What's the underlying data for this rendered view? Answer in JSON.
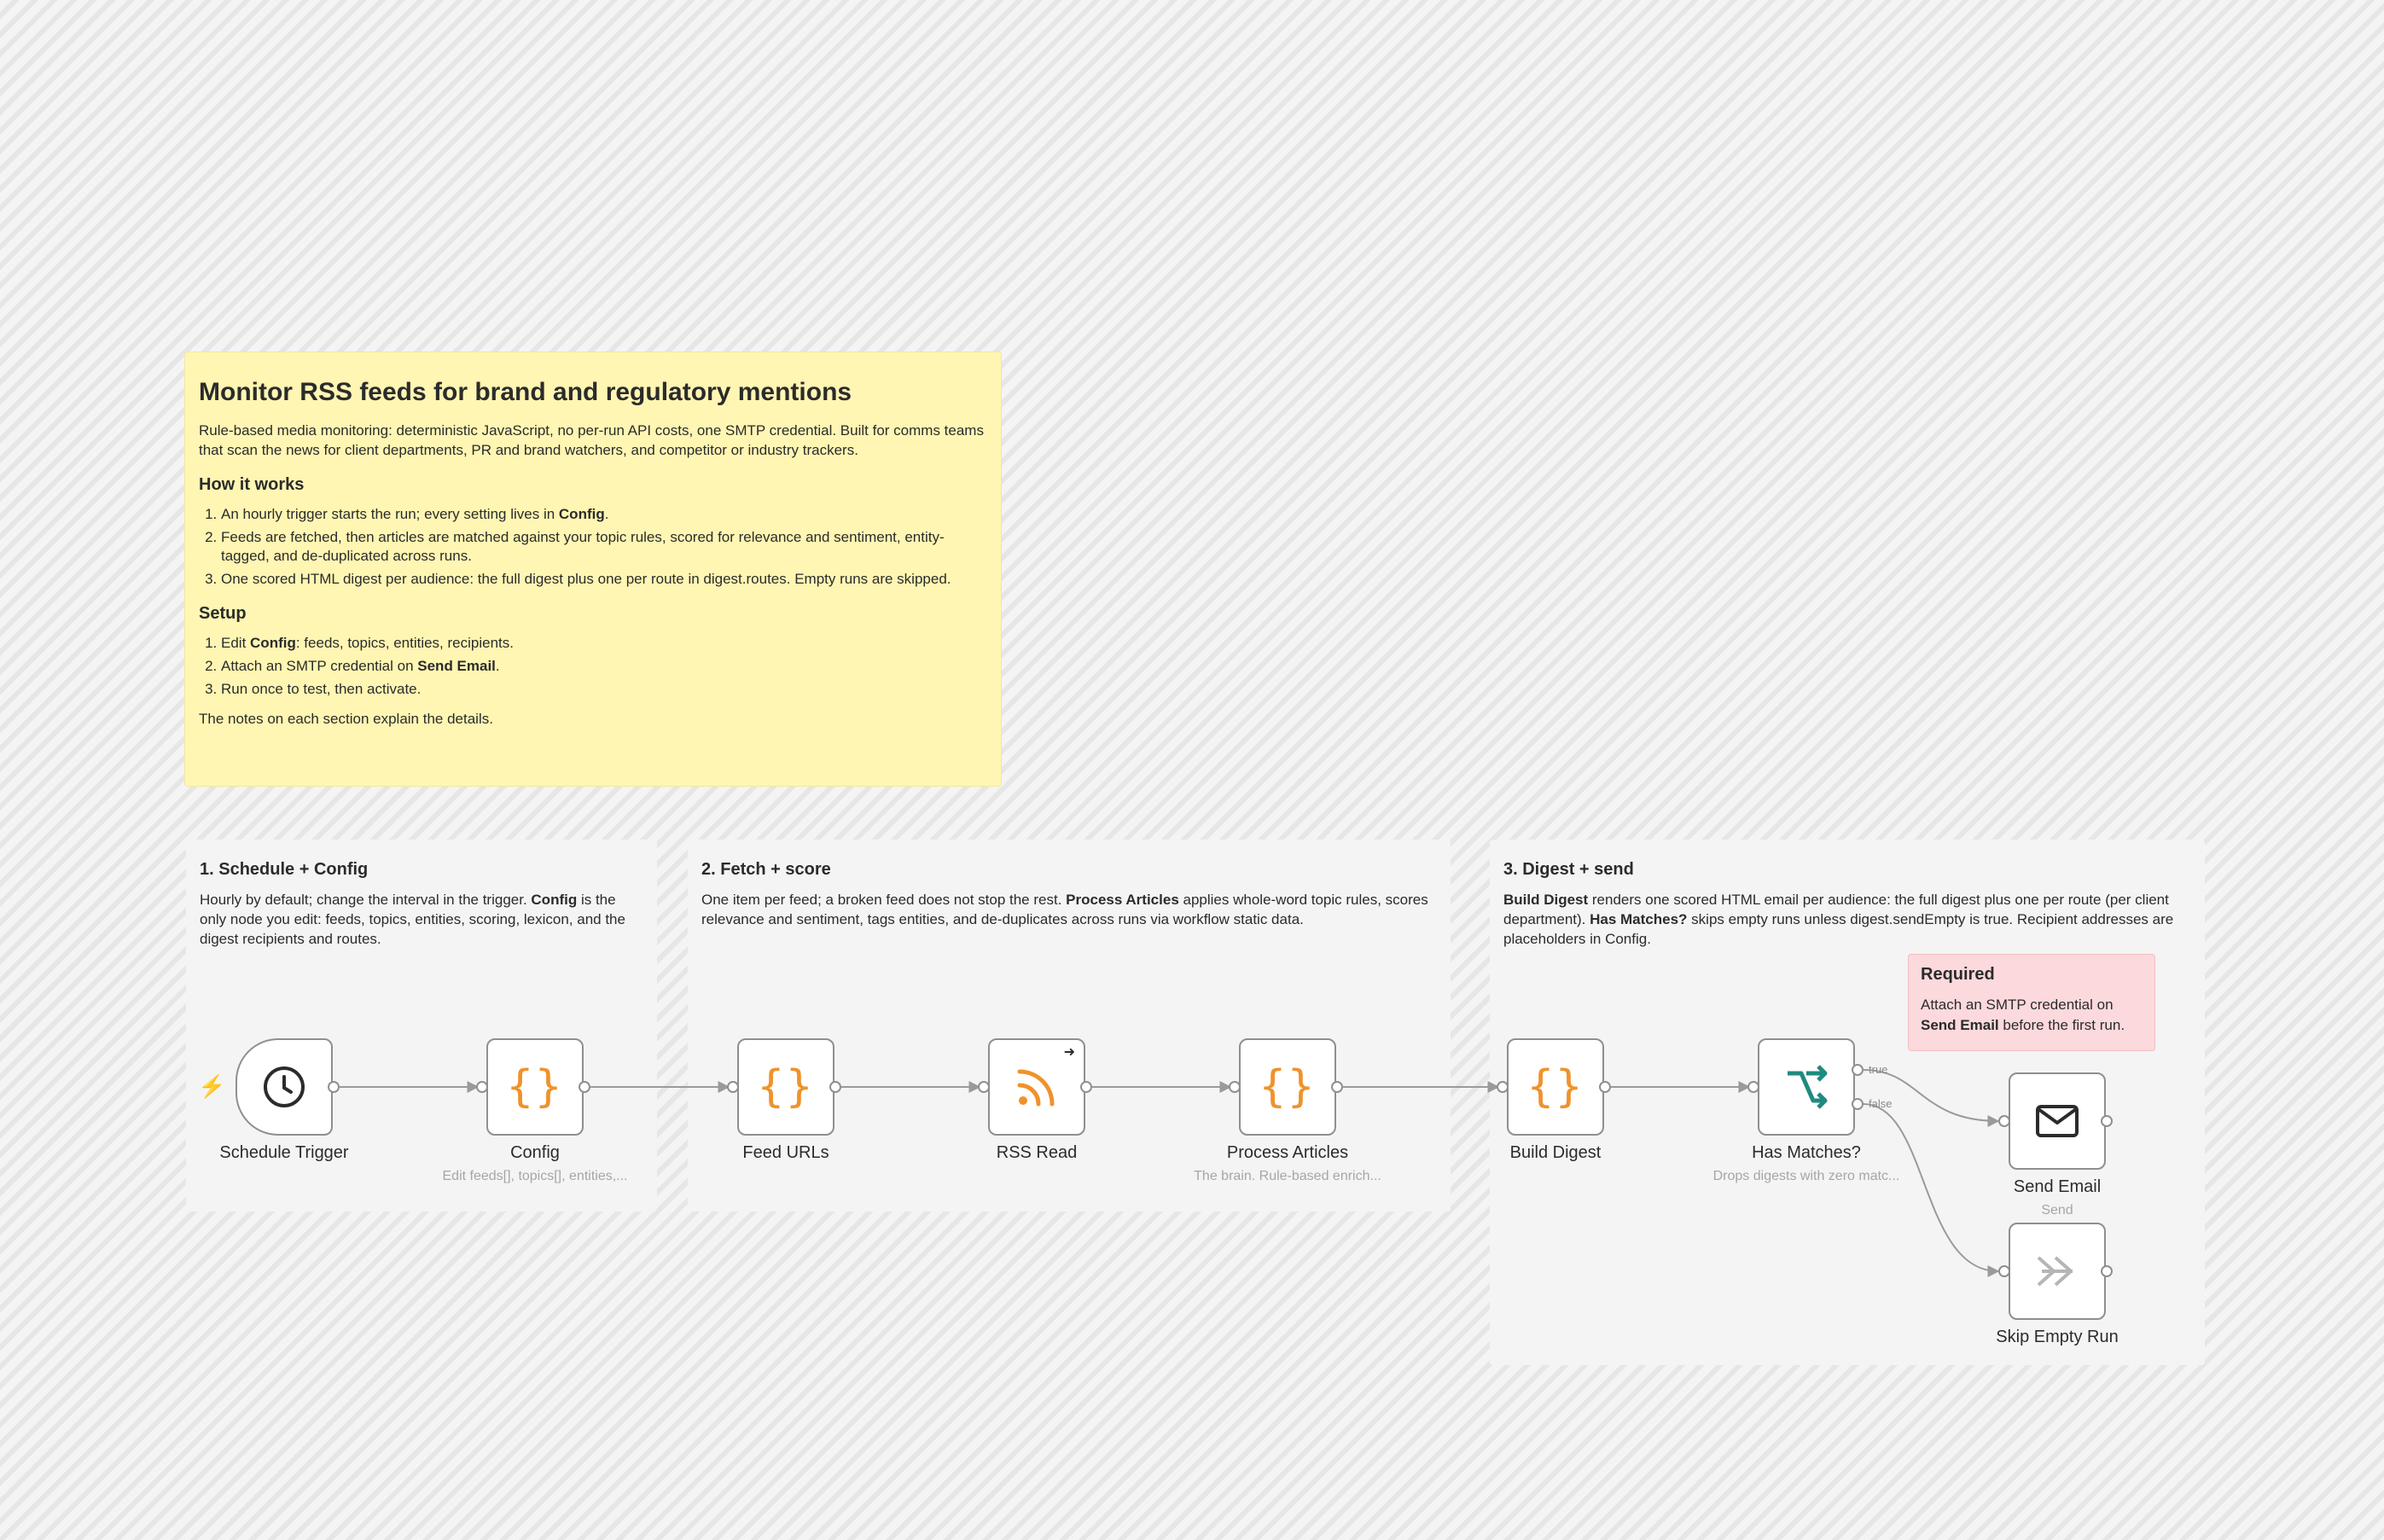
{
  "main_note": {
    "title": "Monitor RSS feeds for brand and regulatory mentions",
    "intro": "Rule-based media monitoring: deterministic JavaScript, no per-run API costs, one SMTP credential. Built for comms teams that scan the news for client departments, PR and brand watchers, and competitor or industry trackers.",
    "how_heading": "How it works",
    "how_1a": "An hourly trigger starts the run; every setting lives in ",
    "how_1b": "Config",
    "how_1c": ".",
    "how_2": "Feeds are fetched, then articles are matched against your topic rules, scored for relevance and sentiment, entity-tagged, and de-duplicated across runs.",
    "how_3": "One scored HTML digest per audience: the full digest plus one per route in digest.routes. Empty runs are skipped.",
    "setup_heading": "Setup",
    "setup_1a": "Edit ",
    "setup_1b": "Config",
    "setup_1c": ": feeds, topics, entities, recipients.",
    "setup_2a": "Attach an SMTP credential on ",
    "setup_2b": "Send Email",
    "setup_2c": ".",
    "setup_3": "Run once to test, then activate.",
    "footer": "The notes on each section explain the details."
  },
  "section1": {
    "title": "1. Schedule + Config",
    "text_a": "Hourly by default; change the interval in the trigger. ",
    "text_b": "Config",
    "text_c": " is the only node you edit: feeds, topics, entities, scoring, lexicon, and the digest recipients and routes."
  },
  "section2": {
    "title": "2. Fetch + score",
    "text_a": "One item per feed; a broken feed does not stop the rest. ",
    "text_b": "Process Articles",
    "text_c": " applies whole-word topic rules, scores relevance and sentiment, tags entities, and de-duplicates across runs via workflow static data."
  },
  "section3": {
    "title": "3. Digest + send",
    "text_a": "Build Digest",
    "text_b": " renders one scored HTML email per audience: the full digest plus one per route (per client department). ",
    "text_c": "Has Matches?",
    "text_d": " skips empty runs unless digest.sendEmpty is true. Recipient addresses are placeholders in Config."
  },
  "required_note": {
    "title": "Required",
    "text_a": "Attach an SMTP credential on ",
    "text_b": "Send Email",
    "text_c": " before the first run."
  },
  "nodes": {
    "schedule_trigger": {
      "label": "Schedule Trigger",
      "icon": "clock-icon"
    },
    "config": {
      "label": "Config",
      "subtitle": "Edit feeds[], topics[], entities,...",
      "icon": "code-braces-icon"
    },
    "feed_urls": {
      "label": "Feed URLs",
      "icon": "code-braces-icon"
    },
    "rss_read": {
      "label": "RSS Read",
      "icon": "rss-icon"
    },
    "process_articles": {
      "label": "Process Articles",
      "subtitle": "The brain. Rule-based enrich...",
      "icon": "code-braces-icon"
    },
    "build_digest": {
      "label": "Build Digest",
      "icon": "code-braces-icon"
    },
    "has_matches": {
      "label": "Has Matches?",
      "subtitle": "Drops digests with zero matc...",
      "icon": "if-branch-icon",
      "true_label": "true",
      "false_label": "false"
    },
    "send_email": {
      "label": "Send Email",
      "subtitle": "Send",
      "icon": "envelope-icon"
    },
    "skip_empty_run": {
      "label": "Skip Empty Run",
      "icon": "noop-arrow-icon"
    }
  },
  "colors": {
    "code_orange": "#f0922b",
    "if_teal": "#1f8a7f",
    "sticky_yellow": "#fff6b3",
    "required_pink": "#fbd9dc",
    "edge_gray": "#9a9a9a"
  }
}
